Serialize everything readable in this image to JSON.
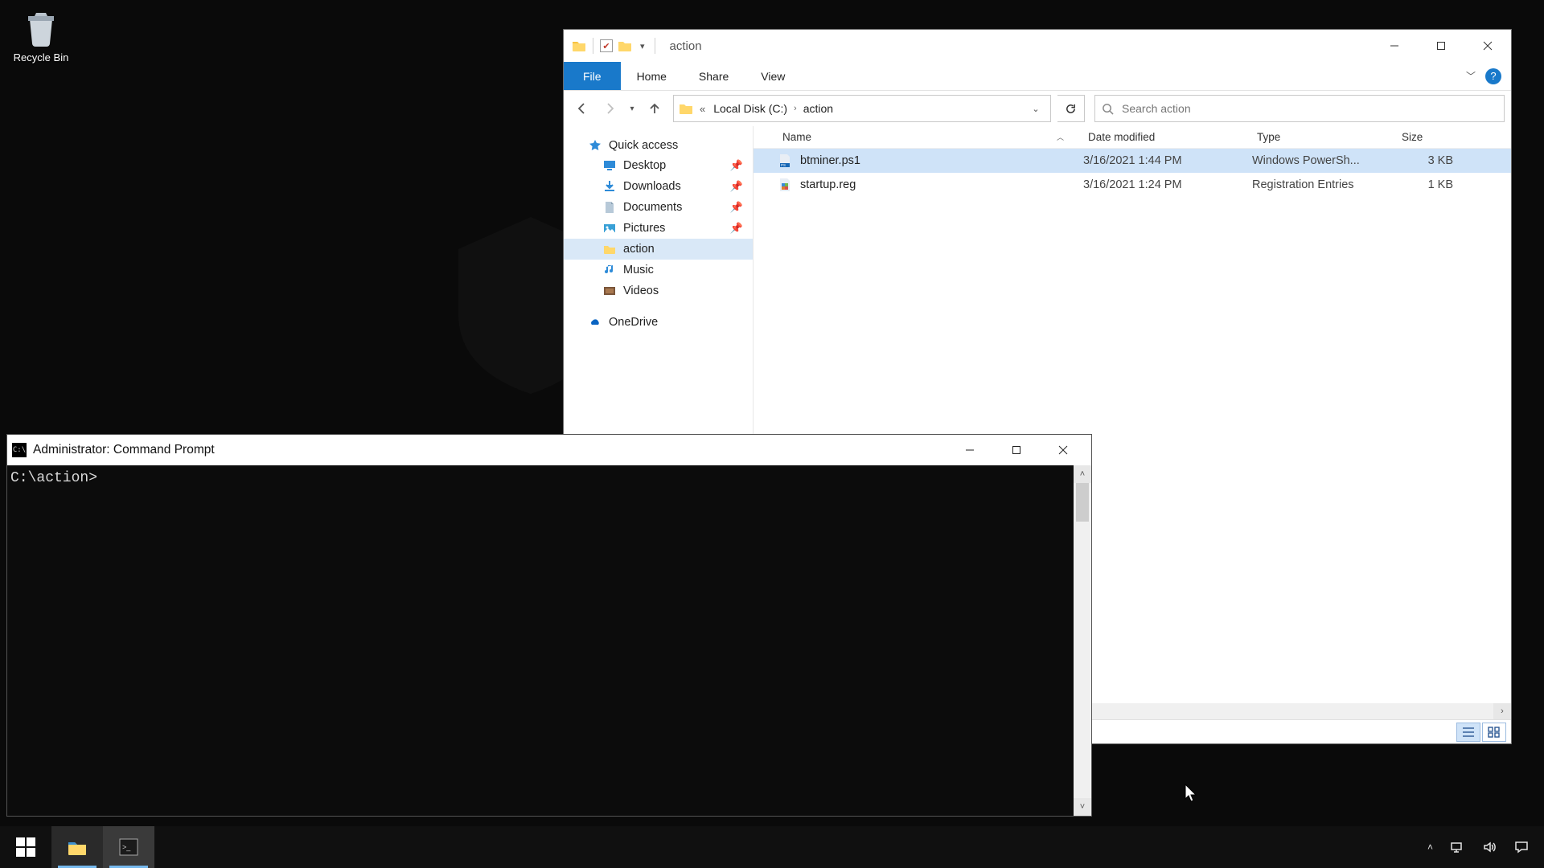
{
  "desktop": {
    "recycle_bin_label": "Recycle Bin"
  },
  "explorer": {
    "window_title": "action",
    "ribbon": {
      "file": "File",
      "home": "Home",
      "share": "Share",
      "view": "View"
    },
    "address": {
      "crumb1": "Local Disk (C:)",
      "crumb2": "action"
    },
    "search_placeholder": "Search action",
    "navpane": {
      "quick_access": "Quick access",
      "desktop": "Desktop",
      "downloads": "Downloads",
      "documents": "Documents",
      "pictures": "Pictures",
      "action": "action",
      "music": "Music",
      "videos": "Videos",
      "onedrive": "OneDrive"
    },
    "columns": {
      "name": "Name",
      "date": "Date modified",
      "type": "Type",
      "size": "Size"
    },
    "files": [
      {
        "name": "btminer.ps1",
        "date": "3/16/2021 1:44 PM",
        "type": "Windows PowerSh...",
        "size": "3 KB",
        "icon": "ps1",
        "selected": true
      },
      {
        "name": "startup.reg",
        "date": "3/16/2021 1:24 PM",
        "type": "Registration Entries",
        "size": "1 KB",
        "icon": "reg",
        "selected": false
      }
    ]
  },
  "cmd": {
    "title": "Administrator: Command Prompt",
    "prompt": "C:\\action>"
  }
}
